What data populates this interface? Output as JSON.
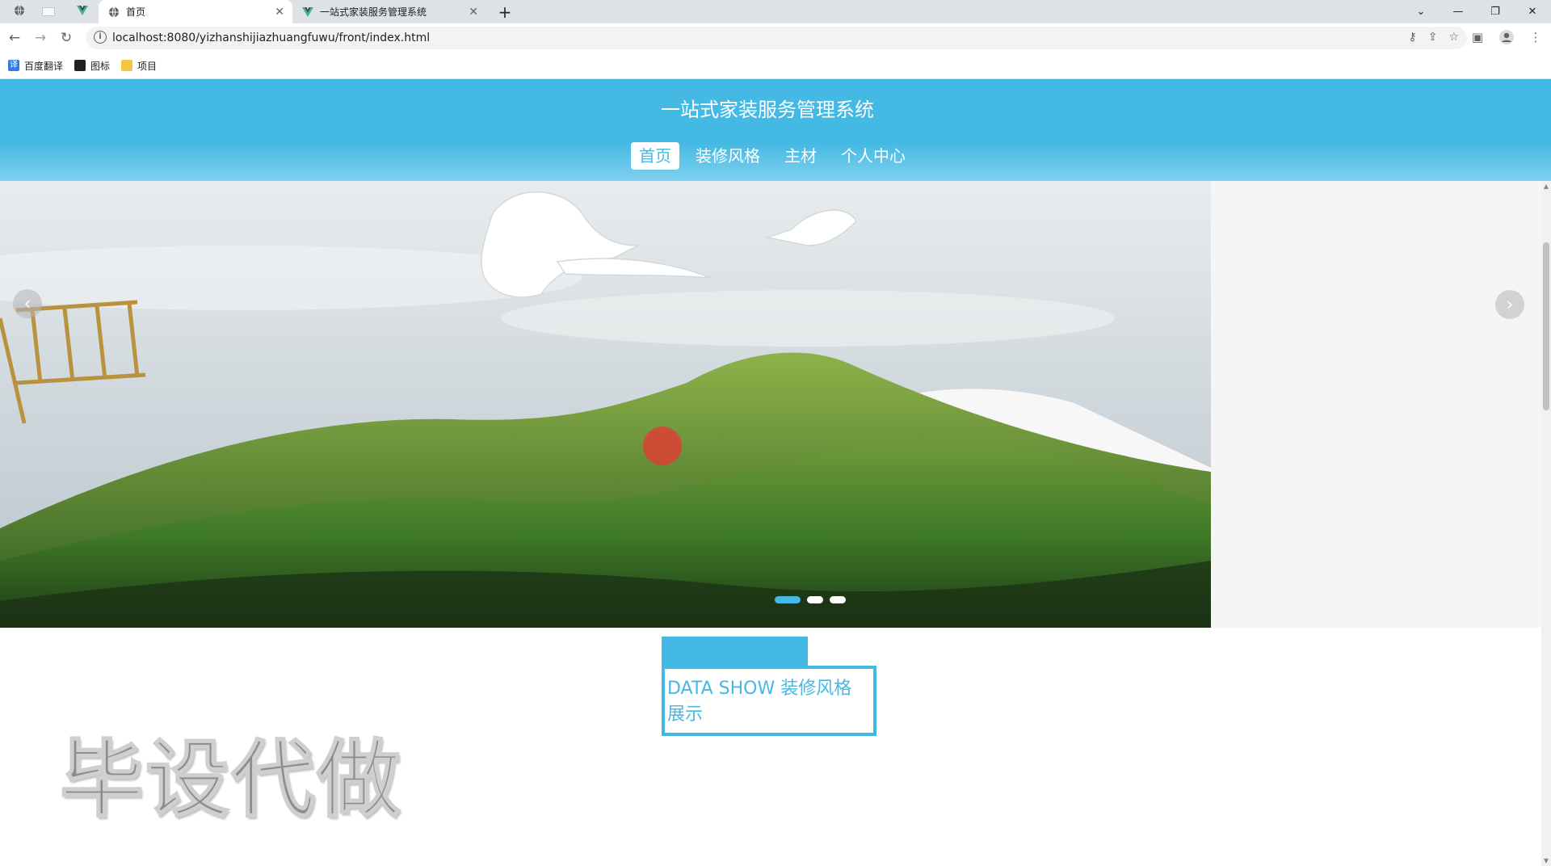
{
  "browser": {
    "tabs": [
      {
        "title": "",
        "icon": "globe-icon",
        "pinned": true
      },
      {
        "title": "",
        "icon": "blank-page-icon",
        "pinned": true
      },
      {
        "title": "",
        "icon": "vue-logo-icon",
        "pinned": true
      },
      {
        "title": "首页",
        "icon": "globe-icon",
        "active": true
      },
      {
        "title": "一站式家装服务管理系统",
        "icon": "vue-logo-icon",
        "active": false
      }
    ],
    "new_tab": "+",
    "url": "localhost:8080/yizhanshijiazhuangfuwu/front/index.html",
    "bookmarks": [
      {
        "label": "百度翻译",
        "icon": "translate-icon"
      },
      {
        "label": "图标",
        "icon": "image-icon"
      },
      {
        "label": "项目",
        "icon": "folder-icon"
      }
    ]
  },
  "site": {
    "title": "一站式家装服务管理系统",
    "nav": [
      {
        "label": "首页",
        "active": true
      },
      {
        "label": "装修风格",
        "active": false
      },
      {
        "label": "主材",
        "active": false
      },
      {
        "label": "个人中心",
        "active": false
      }
    ],
    "accent_color": "#44b9e4"
  },
  "carousel": {
    "slide_count": 3,
    "active_index": 0
  },
  "section": {
    "title": "DATA SHOW 装修风格展示"
  },
  "watermark": "毕设代做"
}
